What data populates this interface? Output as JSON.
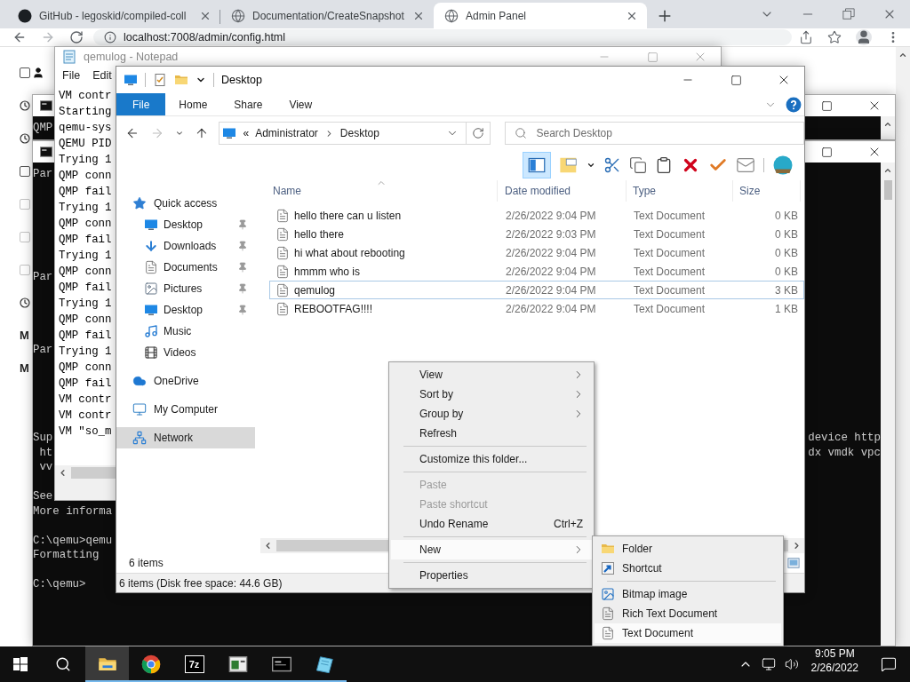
{
  "browser": {
    "tabs": [
      {
        "title": "GitHub - legoskid/compiled-coll",
        "selected": false,
        "kind": "logo"
      },
      {
        "title": "Documentation/CreateSnapshot",
        "selected": false,
        "kind": "globe"
      },
      {
        "title": "Admin Panel",
        "selected": true,
        "kind": "globe"
      }
    ],
    "address": "localhost:7008/admin/config.html"
  },
  "web_page": {
    "items": [
      {
        "kind": "checkbox",
        "checked": false,
        "disabled": false,
        "avatar": true
      },
      {
        "kind": "clock"
      },
      {
        "kind": "clock"
      },
      {
        "kind": "checkbox",
        "checked": false,
        "disabled": false,
        "avatar": false
      },
      {
        "kind": "checkbox",
        "checked": false,
        "disabled": true,
        "avatar": false
      },
      {
        "kind": "checkbox",
        "checked": false,
        "disabled": true,
        "avatar": false
      },
      {
        "kind": "checkbox",
        "checked": false,
        "disabled": true,
        "avatar": false
      },
      {
        "kind": "clock"
      },
      {
        "kind": "heading",
        "text": "M"
      },
      {
        "kind": "heading",
        "text": "M"
      }
    ]
  },
  "console_top": {
    "lines": [
      "QMP"
    ]
  },
  "console": {
    "lines": [
      {
        "kind": "text",
        "left": "Par"
      },
      {
        "kind": "blank"
      },
      {
        "kind": "blank"
      },
      {
        "kind": "blank"
      },
      {
        "kind": "blank"
      },
      {
        "kind": "blank"
      },
      {
        "kind": "blank"
      },
      {
        "kind": "text",
        "left": "Par"
      },
      {
        "kind": "blank"
      },
      {
        "kind": "blank"
      },
      {
        "kind": "blank"
      },
      {
        "kind": "blank"
      },
      {
        "kind": "text",
        "left": "Par"
      },
      {
        "kind": "blank"
      },
      {
        "kind": "blank"
      },
      {
        "kind": "blank"
      },
      {
        "kind": "blank"
      },
      {
        "kind": "blank"
      },
      {
        "kind": "text",
        "left": "Sup",
        "right": "device http"
      },
      {
        "kind": "text",
        "left": " ht",
        "right": "dx vmdk vpc"
      },
      {
        "kind": "text",
        "left": " vv"
      },
      {
        "kind": "blank"
      },
      {
        "kind": "text",
        "left": "See"
      },
      {
        "kind": "text",
        "left": "More informa"
      },
      {
        "kind": "blank"
      },
      {
        "kind": "text",
        "left": "C:\\qemu>qemu"
      },
      {
        "kind": "text",
        "left": "Formatting"
      },
      {
        "kind": "blank"
      },
      {
        "kind": "text",
        "left": "C:\\qemu>"
      }
    ]
  },
  "notepad": {
    "title": "qemulog - Notepad",
    "menu": [
      "File",
      "Edit"
    ],
    "lines": [
      "VM contr",
      "Starting",
      "qemu-sys",
      "QEMU PID",
      "Trying 1",
      "QMP conn",
      "QMP fail",
      "Trying 1",
      "QMP conn",
      "QMP fail",
      "Trying 1",
      "QMP conn",
      "QMP fail",
      "Trying 1",
      "QMP conn",
      "QMP fail",
      "Trying 1",
      "QMP conn",
      "QMP fail",
      "VM contr",
      "VM contr",
      "VM \"so_m"
    ]
  },
  "explorer": {
    "title": "Desktop",
    "ribbon_tabs": [
      {
        "label": "File",
        "kind": "menu"
      },
      {
        "label": "Home",
        "kind": "tab"
      },
      {
        "label": "Share",
        "kind": "tab"
      },
      {
        "label": "View",
        "kind": "tab"
      }
    ],
    "breadcrumb": {
      "overflow": "«",
      "parts": [
        "Administrator",
        "Desktop"
      ]
    },
    "search_placeholder": "Search Desktop",
    "nav": [
      {
        "label": "Quick access",
        "kind": "star",
        "selected": false,
        "children": [
          {
            "label": "Desktop",
            "kind": "desktop",
            "pinned": true,
            "selected": false
          },
          {
            "label": "Downloads",
            "kind": "downloads",
            "pinned": true,
            "selected": false
          },
          {
            "label": "Documents",
            "kind": "documents",
            "pinned": true,
            "selected": false
          },
          {
            "label": "Pictures",
            "kind": "pictures",
            "pinned": true,
            "selected": false
          },
          {
            "label": "Desktop",
            "kind": "desktop",
            "pinned": true,
            "selected": false
          },
          {
            "label": "Music",
            "kind": "music",
            "pinned": false,
            "selected": false
          },
          {
            "label": "Videos",
            "kind": "videos",
            "pinned": false,
            "selected": false
          }
        ]
      },
      {
        "label": "OneDrive",
        "kind": "cloud",
        "selected": false
      },
      {
        "label": "My Computer",
        "kind": "computer",
        "selected": false
      },
      {
        "label": "Network",
        "kind": "network",
        "selected": true
      }
    ],
    "columns": [
      "Name",
      "Date modified",
      "Type",
      "Size"
    ],
    "files": [
      {
        "name": "hello there can u listen",
        "modified": "2/26/2022 9:04 PM",
        "type": "Text Document",
        "size": "0 KB",
        "selected": false
      },
      {
        "name": "hello there",
        "modified": "2/26/2022 9:03 PM",
        "type": "Text Document",
        "size": "0 KB",
        "selected": false
      },
      {
        "name": "hi what about rebooting",
        "modified": "2/26/2022 9:04 PM",
        "type": "Text Document",
        "size": "0 KB",
        "selected": false
      },
      {
        "name": "hmmm who is",
        "modified": "2/26/2022 9:04 PM",
        "type": "Text Document",
        "size": "0 KB",
        "selected": false
      },
      {
        "name": "qemulog",
        "modified": "2/26/2022 9:04 PM",
        "type": "Text Document",
        "size": "3 KB",
        "selected": true
      },
      {
        "name": "REBOOTFAG!!!!",
        "modified": "2/26/2022 9:04 PM",
        "type": "Text Document",
        "size": "1 KB",
        "selected": false
      }
    ],
    "status": "6 items",
    "details": "6 items (Disk free space: 44.6 GB)"
  },
  "context_menu": {
    "items": [
      {
        "kind": "item",
        "label": "View",
        "submenu": true,
        "disabled": false,
        "highlighted": false
      },
      {
        "kind": "item",
        "label": "Sort by",
        "submenu": true,
        "disabled": false,
        "highlighted": false
      },
      {
        "kind": "item",
        "label": "Group by",
        "submenu": true,
        "disabled": false,
        "highlighted": false
      },
      {
        "kind": "item",
        "label": "Refresh",
        "submenu": false,
        "disabled": false,
        "highlighted": false
      },
      {
        "kind": "separator"
      },
      {
        "kind": "item",
        "label": "Customize this folder...",
        "submenu": false,
        "disabled": false,
        "highlighted": false
      },
      {
        "kind": "separator"
      },
      {
        "kind": "item",
        "label": "Paste",
        "submenu": false,
        "disabled": true,
        "highlighted": false
      },
      {
        "kind": "item",
        "label": "Paste shortcut",
        "submenu": false,
        "disabled": true,
        "highlighted": false
      },
      {
        "kind": "item",
        "label": "Undo Rename",
        "shortcut": "Ctrl+Z",
        "submenu": false,
        "disabled": false,
        "highlighted": false
      },
      {
        "kind": "separator"
      },
      {
        "kind": "item",
        "label": "New",
        "submenu": true,
        "disabled": false,
        "highlighted": true
      },
      {
        "kind": "separator"
      },
      {
        "kind": "item",
        "label": "Properties",
        "submenu": false,
        "disabled": false,
        "highlighted": false
      }
    ]
  },
  "submenu": {
    "items": [
      {
        "kind": "folder",
        "label": "Folder",
        "highlighted": false
      },
      {
        "kind": "shortcut",
        "label": "Shortcut",
        "highlighted": false
      },
      {
        "kind": "separator"
      },
      {
        "kind": "bitmap",
        "label": "Bitmap image",
        "highlighted": false
      },
      {
        "kind": "rtf",
        "label": "Rich Text Document",
        "highlighted": false
      },
      {
        "kind": "text",
        "label": "Text Document",
        "highlighted": true
      }
    ]
  },
  "taskbar": {
    "apps": [
      {
        "kind": "explorer",
        "running": true,
        "selected": true
      },
      {
        "kind": "chrome",
        "running": true,
        "selected": false
      },
      {
        "kind": "archiver",
        "label": "7z",
        "running": true,
        "selected": false
      },
      {
        "kind": "window",
        "running": true,
        "selected": false
      },
      {
        "kind": "terminal",
        "running": true,
        "selected": false
      },
      {
        "kind": "editor",
        "running": true,
        "selected": false
      }
    ],
    "time": "9:05 PM",
    "date": "2/26/2022"
  }
}
